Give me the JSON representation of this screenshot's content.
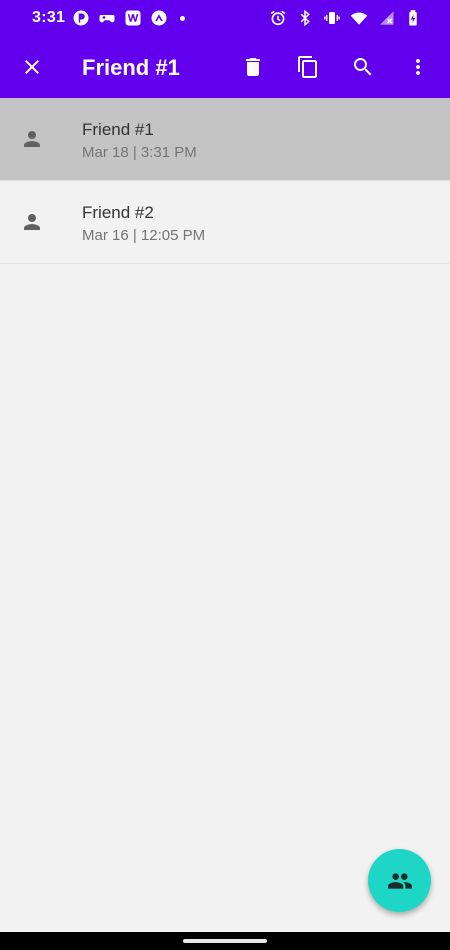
{
  "status_bar": {
    "time": "3:31",
    "left_icons": [
      "notification-app-icon",
      "gamepad-icon",
      "w-app-icon",
      "arrow-up-circle-icon",
      "dot-icon"
    ],
    "right_icons": [
      "alarm-icon",
      "bluetooth-icon",
      "vibrate-icon",
      "wifi-icon",
      "signal-icon",
      "battery-charging-icon"
    ]
  },
  "app_bar": {
    "title": "Friend #1",
    "background": "#6200ee",
    "actions": [
      "close-icon",
      "delete-icon",
      "copy-icon",
      "search-icon",
      "more-vert-icon"
    ]
  },
  "list": {
    "items": [
      {
        "name": "Friend #1",
        "date": "Mar 18 | 3:31 PM",
        "selected": true
      },
      {
        "name": "Friend #2",
        "date": "Mar 16 | 12:05 PM",
        "selected": false
      }
    ],
    "selected_background": "#c4c4c4"
  },
  "fab": {
    "icon": "group-icon",
    "color": "#1ed6c6"
  }
}
